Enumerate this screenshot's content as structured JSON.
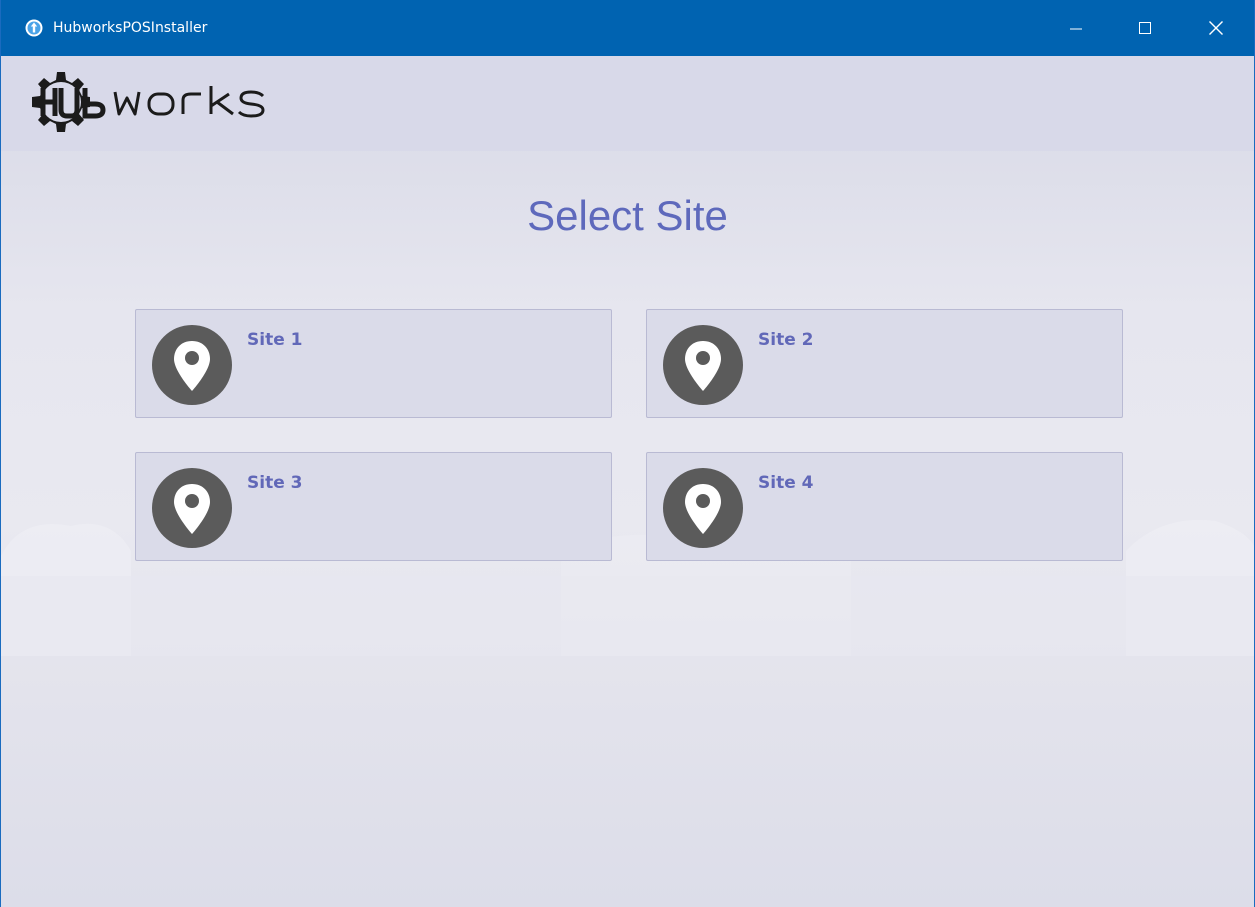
{
  "window": {
    "title": "HubworksPOSInstaller",
    "controls": {
      "minimize_icon": "minimize-icon",
      "maximize_icon": "maximize-icon",
      "close_icon": "close-icon"
    }
  },
  "brand": {
    "logo_text": "HUbWOrKS",
    "logo_icon": "gear-logo"
  },
  "main": {
    "title": "Select Site",
    "sites": [
      {
        "label": "Site 1",
        "icon": "location-pin-icon"
      },
      {
        "label": "Site 2",
        "icon": "location-pin-icon"
      },
      {
        "label": "Site 3",
        "icon": "location-pin-icon"
      },
      {
        "label": "Site 4",
        "icon": "location-pin-icon"
      }
    ]
  },
  "colors": {
    "titlebar": "#0063b1",
    "accent_text": "#5e69bc",
    "site_label": "#6168b8",
    "pin_circle": "#5b5b5b",
    "card_border": "#b9bad3"
  }
}
